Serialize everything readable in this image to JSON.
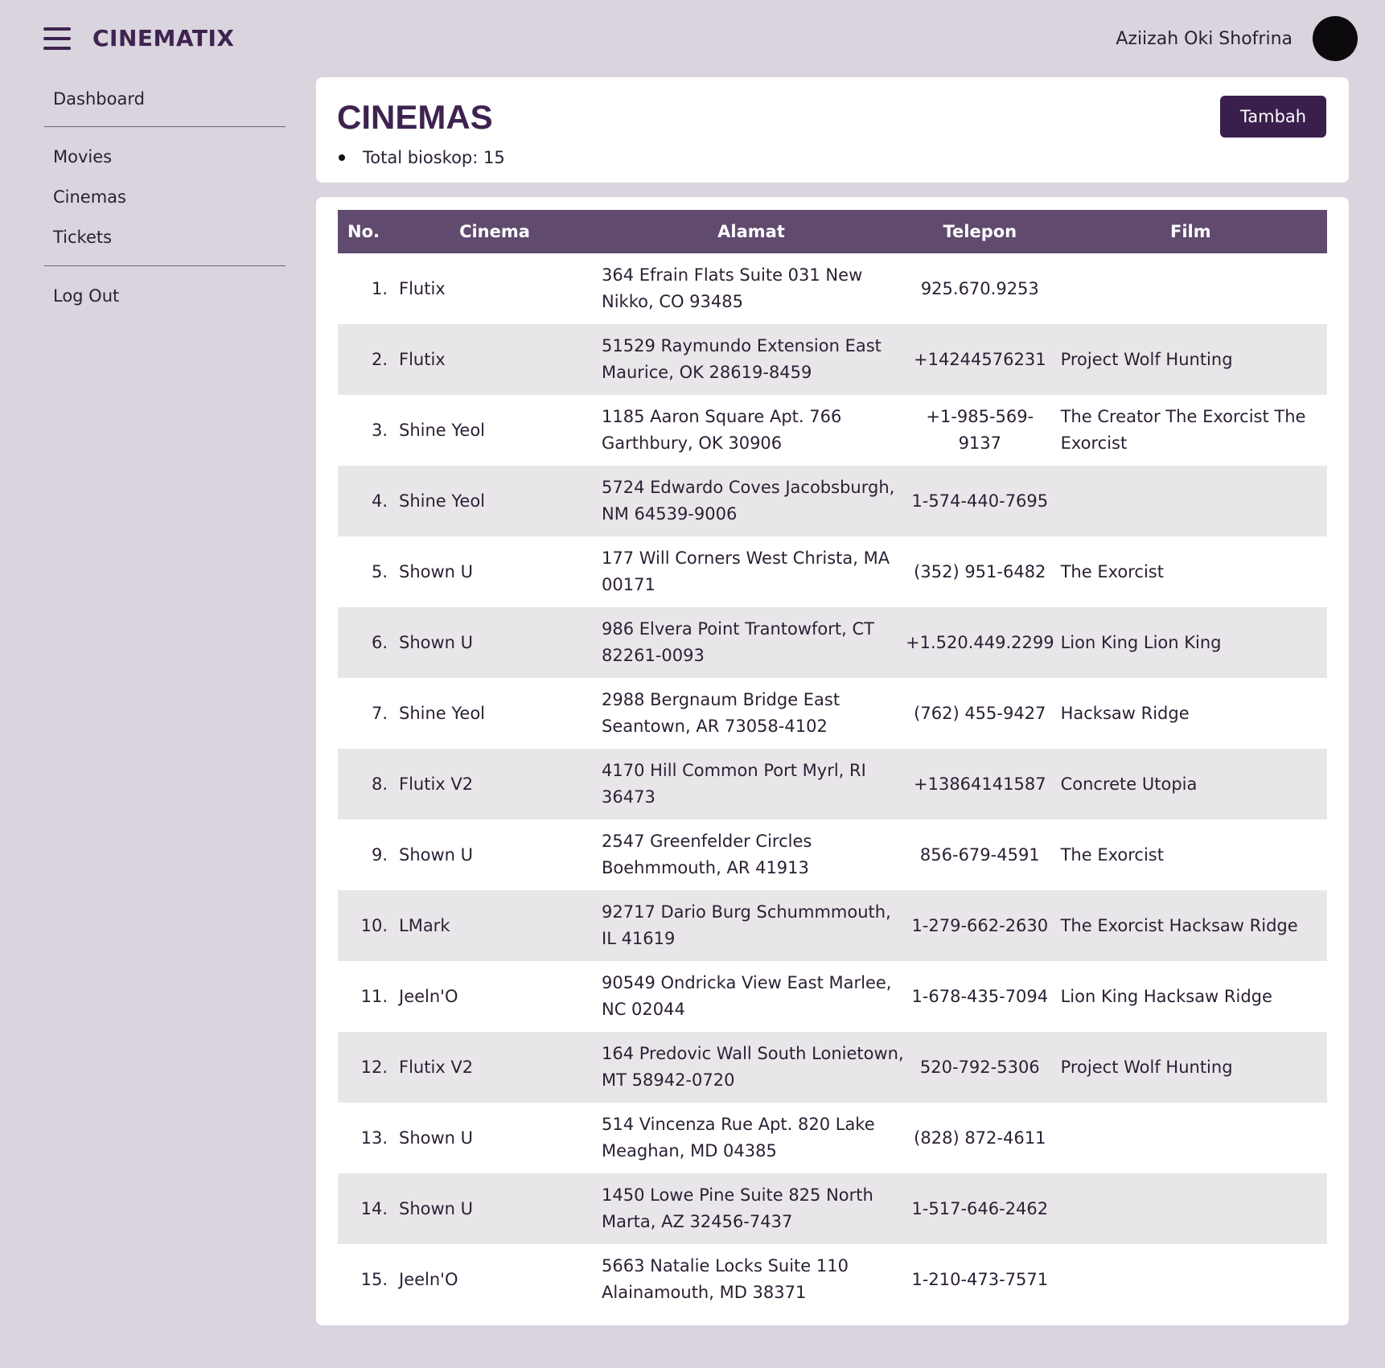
{
  "app": {
    "brand": "CINEMATIX",
    "user_name": "Aziizah Oki Shofrina"
  },
  "sidebar": {
    "items": [
      {
        "label": "Dashboard"
      },
      {
        "label": "Movies"
      },
      {
        "label": "Cinemas"
      },
      {
        "label": "Tickets"
      },
      {
        "label": "Log Out"
      }
    ]
  },
  "header": {
    "title": "CINEMAS",
    "total_label": "Total bioskop: 15",
    "add_button": "Tambah"
  },
  "table": {
    "columns": [
      "No.",
      "Cinema",
      "Alamat",
      "Telepon",
      "Film"
    ],
    "rows": [
      {
        "no": "1.",
        "cinema": "Flutix",
        "alamat": "364 Efrain Flats Suite 031 New Nikko, CO 93485",
        "telepon": "925.670.9253",
        "film": ""
      },
      {
        "no": "2.",
        "cinema": "Flutix",
        "alamat": "51529 Raymundo Extension East Maurice, OK 28619-8459",
        "telepon": "+14244576231",
        "film": "Project Wolf Hunting"
      },
      {
        "no": "3.",
        "cinema": "Shine Yeol",
        "alamat": "1185 Aaron Square Apt. 766 Garthbury, OK 30906",
        "telepon": "+1-985-569-9137",
        "film": "The Creator The Exorcist The Exorcist"
      },
      {
        "no": "4.",
        "cinema": "Shine Yeol",
        "alamat": "5724 Edwardo Coves Jacobsburgh, NM 64539-9006",
        "telepon": "1-574-440-7695",
        "film": ""
      },
      {
        "no": "5.",
        "cinema": "Shown U",
        "alamat": "177 Will Corners West Christa, MA 00171",
        "telepon": "(352) 951-6482",
        "film": "The Exorcist"
      },
      {
        "no": "6.",
        "cinema": "Shown U",
        "alamat": "986 Elvera Point Trantowfort, CT 82261-0093",
        "telepon": "+1.520.449.2299",
        "film": "Lion King Lion King"
      },
      {
        "no": "7.",
        "cinema": "Shine Yeol",
        "alamat": "2988 Bergnaum Bridge East Seantown, AR 73058-4102",
        "telepon": "(762) 455-9427",
        "film": "Hacksaw Ridge"
      },
      {
        "no": "8.",
        "cinema": "Flutix V2",
        "alamat": "4170 Hill Common Port Myrl, RI 36473",
        "telepon": "+13864141587",
        "film": "Concrete Utopia"
      },
      {
        "no": "9.",
        "cinema": "Shown U",
        "alamat": "2547 Greenfelder Circles Boehmmouth, AR 41913",
        "telepon": "856-679-4591",
        "film": "The Exorcist"
      },
      {
        "no": "10.",
        "cinema": "LMark",
        "alamat": "92717 Dario Burg Schummmouth, IL 41619",
        "telepon": "1-279-662-2630",
        "film": "The Exorcist Hacksaw Ridge"
      },
      {
        "no": "11.",
        "cinema": "Jeeln'O",
        "alamat": "90549 Ondricka View East Marlee, NC 02044",
        "telepon": "1-678-435-7094",
        "film": "Lion King Hacksaw Ridge"
      },
      {
        "no": "12.",
        "cinema": "Flutix V2",
        "alamat": "164 Predovic Wall South Lonietown, MT 58942-0720",
        "telepon": "520-792-5306",
        "film": "Project Wolf Hunting"
      },
      {
        "no": "13.",
        "cinema": "Shown U",
        "alamat": "514 Vincenza Rue Apt. 820 Lake Meaghan, MD 04385",
        "telepon": "(828) 872-4611",
        "film": ""
      },
      {
        "no": "14.",
        "cinema": "Shown U",
        "alamat": "1450 Lowe Pine Suite 825 North Marta, AZ 32456-7437",
        "telepon": "1-517-646-2462",
        "film": ""
      },
      {
        "no": "15.",
        "cinema": "Jeeln'O",
        "alamat": "5663 Natalie Locks Suite 110 Alainamouth, MD 38371",
        "telepon": "1-210-473-7571",
        "film": ""
      }
    ]
  },
  "colors": {
    "background": "#d9d4dd",
    "brand": "#3e2350",
    "header_row": "#604a6e",
    "button": "#3a1f4c",
    "stripe": "#e9e6ea"
  },
  "icons": {
    "menu": "hamburger-menu-icon",
    "avatar": "user-avatar"
  }
}
